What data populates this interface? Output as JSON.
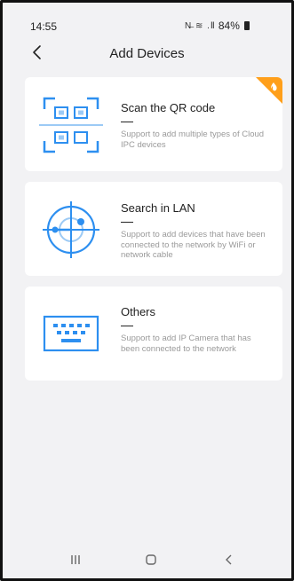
{
  "status_bar": {
    "time": "14:55",
    "signal_icons": "N̶ ≋ .Ⅱ",
    "battery": "84%"
  },
  "header": {
    "title": "Add Devices"
  },
  "cards": [
    {
      "title": "Scan the QR code",
      "description": "Support to add multiple types of Cloud IPC devices",
      "icon": "qr-scan-icon",
      "badge_icon": "fire-icon"
    },
    {
      "title": "Search in LAN",
      "description": "Support to add devices that have been connected to the network by WiFi or network cable",
      "icon": "radar-icon"
    },
    {
      "title": "Others",
      "description": "Support to add IP Camera that has been connected to the network",
      "icon": "keyboard-icon"
    }
  ],
  "colors": {
    "accent_blue": "#2d8ff0",
    "light_blue": "#9ccaf5",
    "badge_orange": "#ff9f1a",
    "background": "#f2f2f4"
  },
  "nav": {
    "recents_icon": "recents-icon",
    "home_icon": "home-icon",
    "back_icon": "back-nav-icon"
  }
}
